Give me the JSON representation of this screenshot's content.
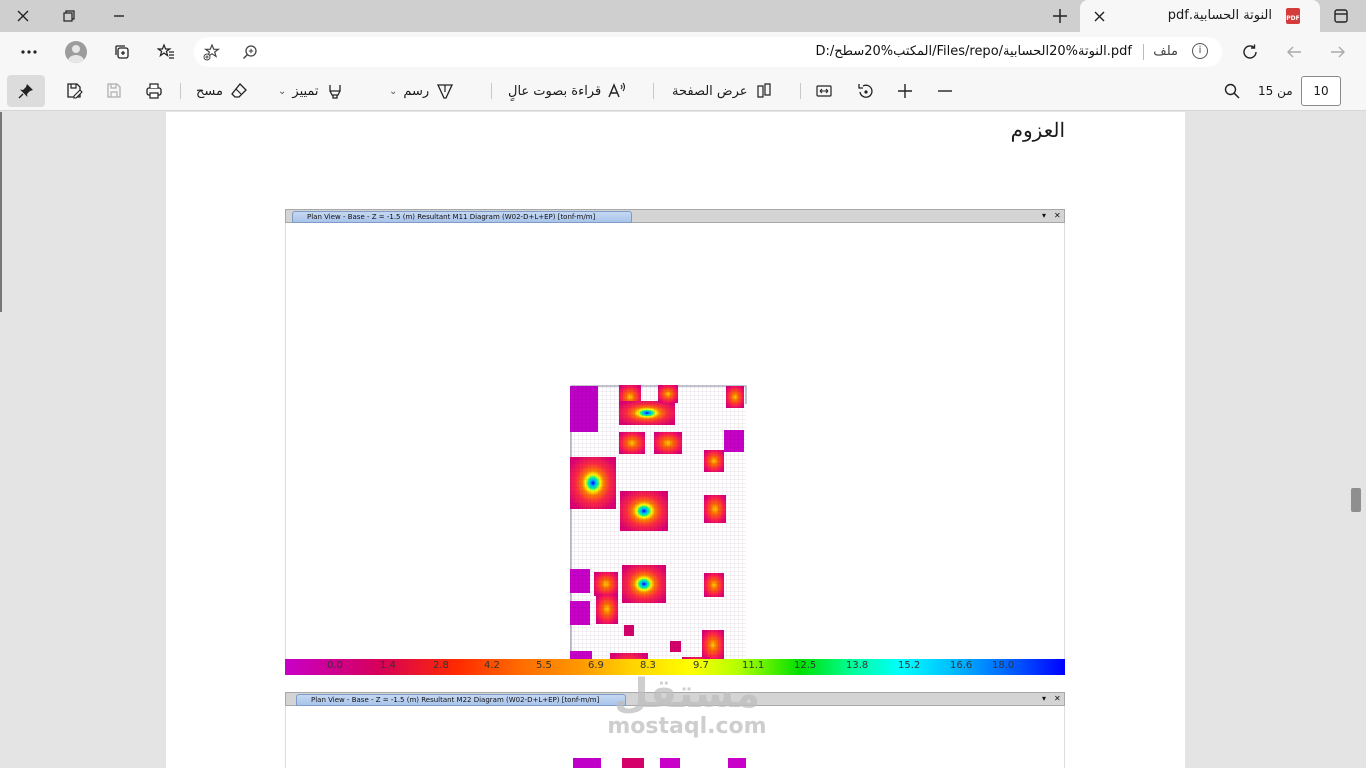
{
  "tab": {
    "title": "النوتة الحسابية.pdf",
    "pdf_badge": "PDF"
  },
  "address": {
    "file_label": "ملف",
    "url": "D:/المكتب%20سطح/Files/repo/النوتة%20الحسابية.pdf"
  },
  "pdf_toolbar": {
    "page_current": "10",
    "page_of": "من 15",
    "view_label": "عرض الصفحة",
    "read_aloud_label": "قراءة بصوت عالٍ",
    "draw_label": "رسم",
    "highlight_label": "تمييز",
    "erase_label": "مسح"
  },
  "document": {
    "heading": "العزوم",
    "figure1_title": "Plan View - Base - Z = -1.5 (m)    Resultant M11 Diagram    (W02-D+L+EP)  [tonf-m/m]",
    "figure2_title": "Plan View - Base - Z = -1.5 (m)    Resultant M22 Diagram    (W02-D+L+EP)  [tonf-m/m]",
    "legend_ticks": [
      "0.0",
      "1.4",
      "2.8",
      "4.2",
      "5.5",
      "6.9",
      "8.3",
      "9.7",
      "11.1",
      "12.5",
      "13.8",
      "15.2",
      "16.6",
      "18.0"
    ],
    "watermark_ar": "مستقل",
    "watermark_en": "mostaql.com"
  },
  "colors": {
    "accent": "#0067c0",
    "legend_low": "#c800c8",
    "legend_high": "#0000ff"
  }
}
